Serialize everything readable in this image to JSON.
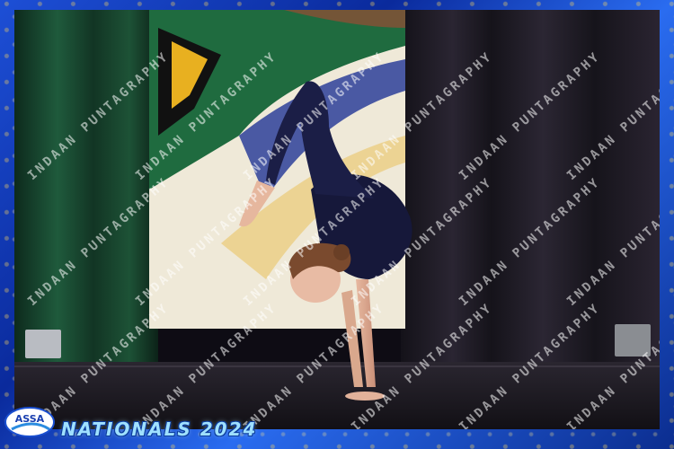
{
  "scene": {
    "description_hidden": false,
    "watermark_text": "INDAAN PUNTAGRAPHY",
    "watermark_color": "#ffffff"
  },
  "overlay": {
    "logo_text": "ASSA",
    "event_title": "NATIONALS 2024"
  },
  "colors": {
    "frame_blue": "#1d4fd6",
    "curtain_dark": "#1a1722",
    "curtain_green": "#1f5a3c",
    "leotard": "#16183a",
    "title_cyan": "#9fe0ff"
  }
}
